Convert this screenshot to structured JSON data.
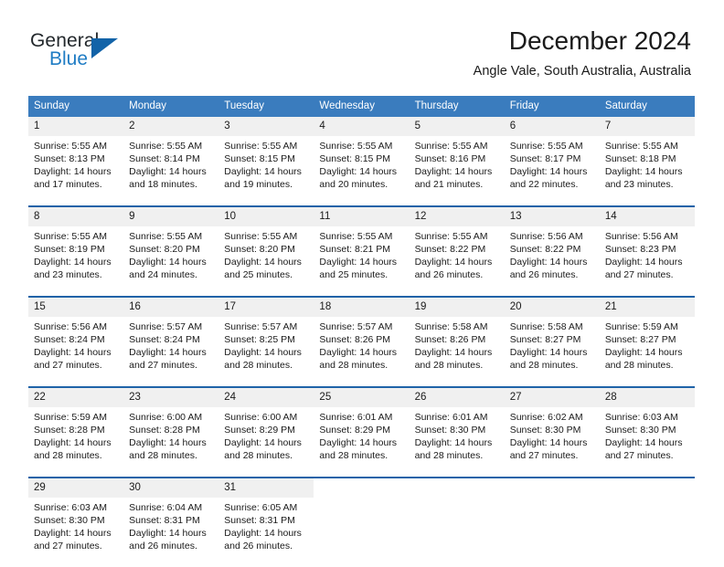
{
  "brand": {
    "name_part1": "General",
    "name_part2": "Blue",
    "accent_color": "#1f7cc4",
    "triangle_color": "#1263a8"
  },
  "header": {
    "month_title": "December 2024",
    "location": "Angle Vale, South Australia, Australia"
  },
  "theme": {
    "header_row_bg": "#3a7cbe",
    "week_separator": "#1f63a8",
    "daynum_bg": "#f0f0f0",
    "text": "#1a1a1a"
  },
  "calendar": {
    "weekday_headers": [
      "Sunday",
      "Monday",
      "Tuesday",
      "Wednesday",
      "Thursday",
      "Friday",
      "Saturday"
    ],
    "weeks": [
      {
        "days": [
          {
            "date": "1",
            "sunrise": "Sunrise: 5:55 AM",
            "sunset": "Sunset: 8:13 PM",
            "daylight_line1": "Daylight: 14 hours",
            "daylight_line2": "and 17 minutes."
          },
          {
            "date": "2",
            "sunrise": "Sunrise: 5:55 AM",
            "sunset": "Sunset: 8:14 PM",
            "daylight_line1": "Daylight: 14 hours",
            "daylight_line2": "and 18 minutes."
          },
          {
            "date": "3",
            "sunrise": "Sunrise: 5:55 AM",
            "sunset": "Sunset: 8:15 PM",
            "daylight_line1": "Daylight: 14 hours",
            "daylight_line2": "and 19 minutes."
          },
          {
            "date": "4",
            "sunrise": "Sunrise: 5:55 AM",
            "sunset": "Sunset: 8:15 PM",
            "daylight_line1": "Daylight: 14 hours",
            "daylight_line2": "and 20 minutes."
          },
          {
            "date": "5",
            "sunrise": "Sunrise: 5:55 AM",
            "sunset": "Sunset: 8:16 PM",
            "daylight_line1": "Daylight: 14 hours",
            "daylight_line2": "and 21 minutes."
          },
          {
            "date": "6",
            "sunrise": "Sunrise: 5:55 AM",
            "sunset": "Sunset: 8:17 PM",
            "daylight_line1": "Daylight: 14 hours",
            "daylight_line2": "and 22 minutes."
          },
          {
            "date": "7",
            "sunrise": "Sunrise: 5:55 AM",
            "sunset": "Sunset: 8:18 PM",
            "daylight_line1": "Daylight: 14 hours",
            "daylight_line2": "and 23 minutes."
          }
        ]
      },
      {
        "days": [
          {
            "date": "8",
            "sunrise": "Sunrise: 5:55 AM",
            "sunset": "Sunset: 8:19 PM",
            "daylight_line1": "Daylight: 14 hours",
            "daylight_line2": "and 23 minutes."
          },
          {
            "date": "9",
            "sunrise": "Sunrise: 5:55 AM",
            "sunset": "Sunset: 8:20 PM",
            "daylight_line1": "Daylight: 14 hours",
            "daylight_line2": "and 24 minutes."
          },
          {
            "date": "10",
            "sunrise": "Sunrise: 5:55 AM",
            "sunset": "Sunset: 8:20 PM",
            "daylight_line1": "Daylight: 14 hours",
            "daylight_line2": "and 25 minutes."
          },
          {
            "date": "11",
            "sunrise": "Sunrise: 5:55 AM",
            "sunset": "Sunset: 8:21 PM",
            "daylight_line1": "Daylight: 14 hours",
            "daylight_line2": "and 25 minutes."
          },
          {
            "date": "12",
            "sunrise": "Sunrise: 5:55 AM",
            "sunset": "Sunset: 8:22 PM",
            "daylight_line1": "Daylight: 14 hours",
            "daylight_line2": "and 26 minutes."
          },
          {
            "date": "13",
            "sunrise": "Sunrise: 5:56 AM",
            "sunset": "Sunset: 8:22 PM",
            "daylight_line1": "Daylight: 14 hours",
            "daylight_line2": "and 26 minutes."
          },
          {
            "date": "14",
            "sunrise": "Sunrise: 5:56 AM",
            "sunset": "Sunset: 8:23 PM",
            "daylight_line1": "Daylight: 14 hours",
            "daylight_line2": "and 27 minutes."
          }
        ]
      },
      {
        "days": [
          {
            "date": "15",
            "sunrise": "Sunrise: 5:56 AM",
            "sunset": "Sunset: 8:24 PM",
            "daylight_line1": "Daylight: 14 hours",
            "daylight_line2": "and 27 minutes."
          },
          {
            "date": "16",
            "sunrise": "Sunrise: 5:57 AM",
            "sunset": "Sunset: 8:24 PM",
            "daylight_line1": "Daylight: 14 hours",
            "daylight_line2": "and 27 minutes."
          },
          {
            "date": "17",
            "sunrise": "Sunrise: 5:57 AM",
            "sunset": "Sunset: 8:25 PM",
            "daylight_line1": "Daylight: 14 hours",
            "daylight_line2": "and 28 minutes."
          },
          {
            "date": "18",
            "sunrise": "Sunrise: 5:57 AM",
            "sunset": "Sunset: 8:26 PM",
            "daylight_line1": "Daylight: 14 hours",
            "daylight_line2": "and 28 minutes."
          },
          {
            "date": "19",
            "sunrise": "Sunrise: 5:58 AM",
            "sunset": "Sunset: 8:26 PM",
            "daylight_line1": "Daylight: 14 hours",
            "daylight_line2": "and 28 minutes."
          },
          {
            "date": "20",
            "sunrise": "Sunrise: 5:58 AM",
            "sunset": "Sunset: 8:27 PM",
            "daylight_line1": "Daylight: 14 hours",
            "daylight_line2": "and 28 minutes."
          },
          {
            "date": "21",
            "sunrise": "Sunrise: 5:59 AM",
            "sunset": "Sunset: 8:27 PM",
            "daylight_line1": "Daylight: 14 hours",
            "daylight_line2": "and 28 minutes."
          }
        ]
      },
      {
        "days": [
          {
            "date": "22",
            "sunrise": "Sunrise: 5:59 AM",
            "sunset": "Sunset: 8:28 PM",
            "daylight_line1": "Daylight: 14 hours",
            "daylight_line2": "and 28 minutes."
          },
          {
            "date": "23",
            "sunrise": "Sunrise: 6:00 AM",
            "sunset": "Sunset: 8:28 PM",
            "daylight_line1": "Daylight: 14 hours",
            "daylight_line2": "and 28 minutes."
          },
          {
            "date": "24",
            "sunrise": "Sunrise: 6:00 AM",
            "sunset": "Sunset: 8:29 PM",
            "daylight_line1": "Daylight: 14 hours",
            "daylight_line2": "and 28 minutes."
          },
          {
            "date": "25",
            "sunrise": "Sunrise: 6:01 AM",
            "sunset": "Sunset: 8:29 PM",
            "daylight_line1": "Daylight: 14 hours",
            "daylight_line2": "and 28 minutes."
          },
          {
            "date": "26",
            "sunrise": "Sunrise: 6:01 AM",
            "sunset": "Sunset: 8:30 PM",
            "daylight_line1": "Daylight: 14 hours",
            "daylight_line2": "and 28 minutes."
          },
          {
            "date": "27",
            "sunrise": "Sunrise: 6:02 AM",
            "sunset": "Sunset: 8:30 PM",
            "daylight_line1": "Daylight: 14 hours",
            "daylight_line2": "and 27 minutes."
          },
          {
            "date": "28",
            "sunrise": "Sunrise: 6:03 AM",
            "sunset": "Sunset: 8:30 PM",
            "daylight_line1": "Daylight: 14 hours",
            "daylight_line2": "and 27 minutes."
          }
        ]
      },
      {
        "days": [
          {
            "date": "29",
            "sunrise": "Sunrise: 6:03 AM",
            "sunset": "Sunset: 8:30 PM",
            "daylight_line1": "Daylight: 14 hours",
            "daylight_line2": "and 27 minutes."
          },
          {
            "date": "30",
            "sunrise": "Sunrise: 6:04 AM",
            "sunset": "Sunset: 8:31 PM",
            "daylight_line1": "Daylight: 14 hours",
            "daylight_line2": "and 26 minutes."
          },
          {
            "date": "31",
            "sunrise": "Sunrise: 6:05 AM",
            "sunset": "Sunset: 8:31 PM",
            "daylight_line1": "Daylight: 14 hours",
            "daylight_line2": "and 26 minutes."
          },
          {
            "date": "",
            "sunrise": "",
            "sunset": "",
            "daylight_line1": "",
            "daylight_line2": ""
          },
          {
            "date": "",
            "sunrise": "",
            "sunset": "",
            "daylight_line1": "",
            "daylight_line2": ""
          },
          {
            "date": "",
            "sunrise": "",
            "sunset": "",
            "daylight_line1": "",
            "daylight_line2": ""
          },
          {
            "date": "",
            "sunrise": "",
            "sunset": "",
            "daylight_line1": "",
            "daylight_line2": ""
          }
        ]
      }
    ]
  }
}
